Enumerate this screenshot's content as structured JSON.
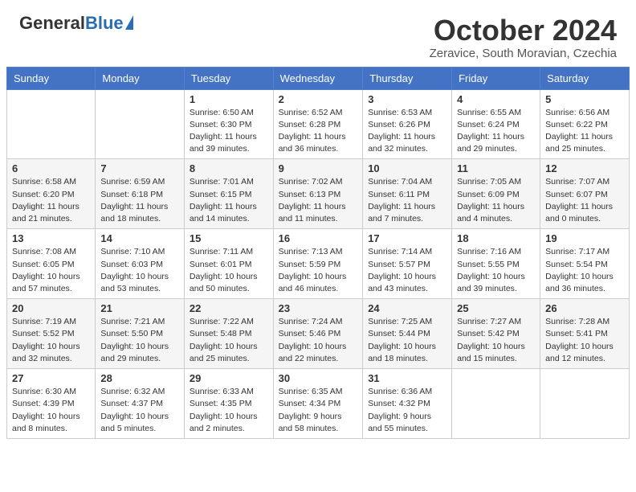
{
  "header": {
    "logo_general": "General",
    "logo_blue": "Blue",
    "month_title": "October 2024",
    "location": "Zeravice, South Moravian, Czechia"
  },
  "days_of_week": [
    "Sunday",
    "Monday",
    "Tuesday",
    "Wednesday",
    "Thursday",
    "Friday",
    "Saturday"
  ],
  "weeks": [
    [
      {
        "day": "",
        "info": ""
      },
      {
        "day": "",
        "info": ""
      },
      {
        "day": "1",
        "sunrise": "Sunrise: 6:50 AM",
        "sunset": "Sunset: 6:30 PM",
        "daylight": "Daylight: 11 hours and 39 minutes."
      },
      {
        "day": "2",
        "sunrise": "Sunrise: 6:52 AM",
        "sunset": "Sunset: 6:28 PM",
        "daylight": "Daylight: 11 hours and 36 minutes."
      },
      {
        "day": "3",
        "sunrise": "Sunrise: 6:53 AM",
        "sunset": "Sunset: 6:26 PM",
        "daylight": "Daylight: 11 hours and 32 minutes."
      },
      {
        "day": "4",
        "sunrise": "Sunrise: 6:55 AM",
        "sunset": "Sunset: 6:24 PM",
        "daylight": "Daylight: 11 hours and 29 minutes."
      },
      {
        "day": "5",
        "sunrise": "Sunrise: 6:56 AM",
        "sunset": "Sunset: 6:22 PM",
        "daylight": "Daylight: 11 hours and 25 minutes."
      }
    ],
    [
      {
        "day": "6",
        "sunrise": "Sunrise: 6:58 AM",
        "sunset": "Sunset: 6:20 PM",
        "daylight": "Daylight: 11 hours and 21 minutes."
      },
      {
        "day": "7",
        "sunrise": "Sunrise: 6:59 AM",
        "sunset": "Sunset: 6:18 PM",
        "daylight": "Daylight: 11 hours and 18 minutes."
      },
      {
        "day": "8",
        "sunrise": "Sunrise: 7:01 AM",
        "sunset": "Sunset: 6:15 PM",
        "daylight": "Daylight: 11 hours and 14 minutes."
      },
      {
        "day": "9",
        "sunrise": "Sunrise: 7:02 AM",
        "sunset": "Sunset: 6:13 PM",
        "daylight": "Daylight: 11 hours and 11 minutes."
      },
      {
        "day": "10",
        "sunrise": "Sunrise: 7:04 AM",
        "sunset": "Sunset: 6:11 PM",
        "daylight": "Daylight: 11 hours and 7 minutes."
      },
      {
        "day": "11",
        "sunrise": "Sunrise: 7:05 AM",
        "sunset": "Sunset: 6:09 PM",
        "daylight": "Daylight: 11 hours and 4 minutes."
      },
      {
        "day": "12",
        "sunrise": "Sunrise: 7:07 AM",
        "sunset": "Sunset: 6:07 PM",
        "daylight": "Daylight: 11 hours and 0 minutes."
      }
    ],
    [
      {
        "day": "13",
        "sunrise": "Sunrise: 7:08 AM",
        "sunset": "Sunset: 6:05 PM",
        "daylight": "Daylight: 10 hours and 57 minutes."
      },
      {
        "day": "14",
        "sunrise": "Sunrise: 7:10 AM",
        "sunset": "Sunset: 6:03 PM",
        "daylight": "Daylight: 10 hours and 53 minutes."
      },
      {
        "day": "15",
        "sunrise": "Sunrise: 7:11 AM",
        "sunset": "Sunset: 6:01 PM",
        "daylight": "Daylight: 10 hours and 50 minutes."
      },
      {
        "day": "16",
        "sunrise": "Sunrise: 7:13 AM",
        "sunset": "Sunset: 5:59 PM",
        "daylight": "Daylight: 10 hours and 46 minutes."
      },
      {
        "day": "17",
        "sunrise": "Sunrise: 7:14 AM",
        "sunset": "Sunset: 5:57 PM",
        "daylight": "Daylight: 10 hours and 43 minutes."
      },
      {
        "day": "18",
        "sunrise": "Sunrise: 7:16 AM",
        "sunset": "Sunset: 5:55 PM",
        "daylight": "Daylight: 10 hours and 39 minutes."
      },
      {
        "day": "19",
        "sunrise": "Sunrise: 7:17 AM",
        "sunset": "Sunset: 5:54 PM",
        "daylight": "Daylight: 10 hours and 36 minutes."
      }
    ],
    [
      {
        "day": "20",
        "sunrise": "Sunrise: 7:19 AM",
        "sunset": "Sunset: 5:52 PM",
        "daylight": "Daylight: 10 hours and 32 minutes."
      },
      {
        "day": "21",
        "sunrise": "Sunrise: 7:21 AM",
        "sunset": "Sunset: 5:50 PM",
        "daylight": "Daylight: 10 hours and 29 minutes."
      },
      {
        "day": "22",
        "sunrise": "Sunrise: 7:22 AM",
        "sunset": "Sunset: 5:48 PM",
        "daylight": "Daylight: 10 hours and 25 minutes."
      },
      {
        "day": "23",
        "sunrise": "Sunrise: 7:24 AM",
        "sunset": "Sunset: 5:46 PM",
        "daylight": "Daylight: 10 hours and 22 minutes."
      },
      {
        "day": "24",
        "sunrise": "Sunrise: 7:25 AM",
        "sunset": "Sunset: 5:44 PM",
        "daylight": "Daylight: 10 hours and 18 minutes."
      },
      {
        "day": "25",
        "sunrise": "Sunrise: 7:27 AM",
        "sunset": "Sunset: 5:42 PM",
        "daylight": "Daylight: 10 hours and 15 minutes."
      },
      {
        "day": "26",
        "sunrise": "Sunrise: 7:28 AM",
        "sunset": "Sunset: 5:41 PM",
        "daylight": "Daylight: 10 hours and 12 minutes."
      }
    ],
    [
      {
        "day": "27",
        "sunrise": "Sunrise: 6:30 AM",
        "sunset": "Sunset: 4:39 PM",
        "daylight": "Daylight: 10 hours and 8 minutes."
      },
      {
        "day": "28",
        "sunrise": "Sunrise: 6:32 AM",
        "sunset": "Sunset: 4:37 PM",
        "daylight": "Daylight: 10 hours and 5 minutes."
      },
      {
        "day": "29",
        "sunrise": "Sunrise: 6:33 AM",
        "sunset": "Sunset: 4:35 PM",
        "daylight": "Daylight: 10 hours and 2 minutes."
      },
      {
        "day": "30",
        "sunrise": "Sunrise: 6:35 AM",
        "sunset": "Sunset: 4:34 PM",
        "daylight": "Daylight: 9 hours and 58 minutes."
      },
      {
        "day": "31",
        "sunrise": "Sunrise: 6:36 AM",
        "sunset": "Sunset: 4:32 PM",
        "daylight": "Daylight: 9 hours and 55 minutes."
      },
      {
        "day": "",
        "info": ""
      },
      {
        "day": "",
        "info": ""
      }
    ]
  ]
}
